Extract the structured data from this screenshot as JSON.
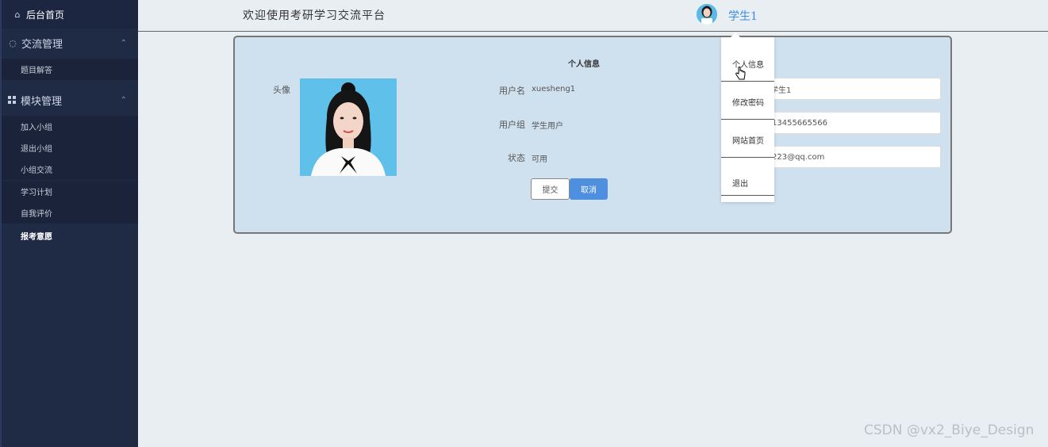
{
  "sidebar": {
    "home": {
      "icon": "home-icon",
      "label": "后台首页"
    },
    "groups": [
      {
        "icon": "chat-icon",
        "label": "交流管理",
        "chevron": "chevron-up-icon",
        "items": [
          "题目解答"
        ]
      },
      {
        "icon": "grid-icon",
        "label": "模块管理",
        "chevron": "chevron-up-icon",
        "items": [
          "加入小组",
          "退出小组",
          "小组交流",
          "学习计划",
          "自我评价",
          "报考意愿"
        ]
      }
    ]
  },
  "header": {
    "welcome": "欢迎使用考研学习交流平台",
    "user_name": "学生1",
    "avatar_icon": "avatar-icon"
  },
  "profile": {
    "title": "个人信息",
    "avatar_label": "头像",
    "username_label": "用户名",
    "username_value": "xuesheng1",
    "group_label": "用户组",
    "group_value": "学生用户",
    "status_label": "状态",
    "status_value": "可用",
    "inputs": [
      "学生1",
      "13455665566",
      "223@qq.com"
    ],
    "submit": "提交",
    "cancel": "取消"
  },
  "dropdown": {
    "items": [
      "个人信息",
      "修改密码",
      "网站首页",
      "退出"
    ]
  },
  "watermark": "CSDN @vx2_Biye_Design",
  "colors": {
    "sidebar": "#1f2a45",
    "accent": "#4f8fe0",
    "card": "#cfe0ee",
    "link": "#3a8ee6"
  }
}
